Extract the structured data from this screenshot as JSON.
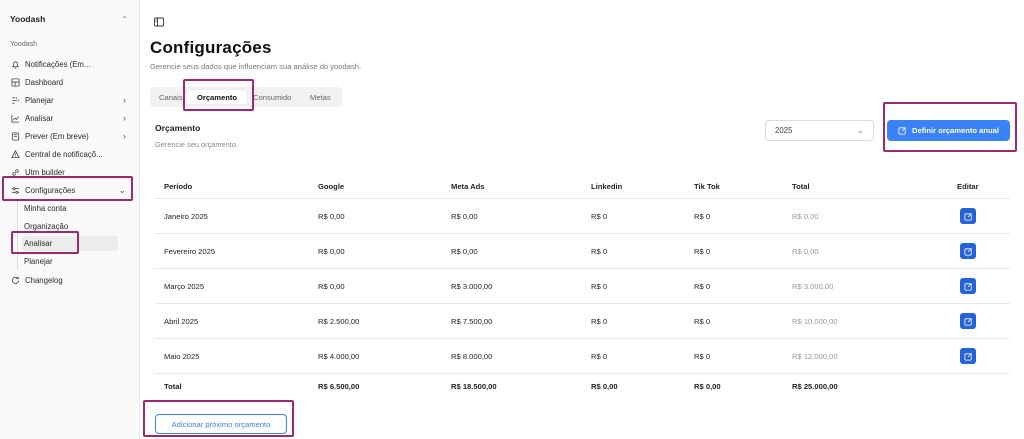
{
  "sidebar": {
    "workspace": "Yoodash",
    "section_label": "Yoodash",
    "items": [
      {
        "label": "Notificações (Em...",
        "icon": "bell-icon"
      },
      {
        "label": "Dashboard",
        "icon": "dashboard-icon"
      },
      {
        "label": "Planejar",
        "icon": "plan-icon"
      },
      {
        "label": "Analisar",
        "icon": "chart-icon"
      },
      {
        "label": "Prever (Em breve)",
        "icon": "forecast-icon"
      },
      {
        "label": "Central de notificaçõ...",
        "icon": "alert-icon"
      },
      {
        "label": "Utm builder",
        "icon": "link-icon"
      },
      {
        "label": "Configurações",
        "icon": "sliders-icon"
      }
    ],
    "sub_items": [
      "Minha conta",
      "Organização",
      "Analisar",
      "Planejar"
    ],
    "changelog": "Changelog"
  },
  "page": {
    "title": "Configurações",
    "subtitle": "Gerencie seus dados que influenciam sua análise do yoodash."
  },
  "tabs": [
    "Canais",
    "Orçamento",
    "Consumido",
    "Metas"
  ],
  "card": {
    "title": "Orçamento",
    "subtitle": "Gerencie seu orçamento.",
    "year": "2025",
    "define_button": "Definir orçamento anual",
    "add_button": "Adicionar próximo orçamento"
  },
  "table": {
    "headers": [
      "Período",
      "Google",
      "Meta Ads",
      "Linkedin",
      "Tik Tok",
      "Total",
      "Editar"
    ],
    "rows": [
      [
        "Janeiro 2025",
        "R$ 0,00",
        "R$ 0,00",
        "R$ 0",
        "R$ 0",
        "R$ 0,00"
      ],
      [
        "Fevereiro 2025",
        "R$ 0,00",
        "R$ 0,00",
        "R$ 0",
        "R$ 0",
        "R$ 0,00"
      ],
      [
        "Março 2025",
        "R$ 0,00",
        "R$ 3.000,00",
        "R$ 0",
        "R$ 0",
        "R$ 3.000,00"
      ],
      [
        "Abril 2025",
        "R$ 2.500,00",
        "R$ 7.500,00",
        "R$ 0",
        "R$ 0",
        "R$ 10.000,00"
      ],
      [
        "Maio 2025",
        "R$ 4.000,00",
        "R$ 8.000,00",
        "R$ 0",
        "R$ 0",
        "R$ 12.000,00"
      ]
    ],
    "total": [
      "Total",
      "R$ 6.500,00",
      "R$ 18.500,00",
      "R$ 0,00",
      "R$ 0,00",
      "R$ 25.000,00"
    ]
  },
  "colors": {
    "accent": "#3b82f6",
    "edit_button": "#2563d9",
    "highlight": "#a0286e"
  }
}
